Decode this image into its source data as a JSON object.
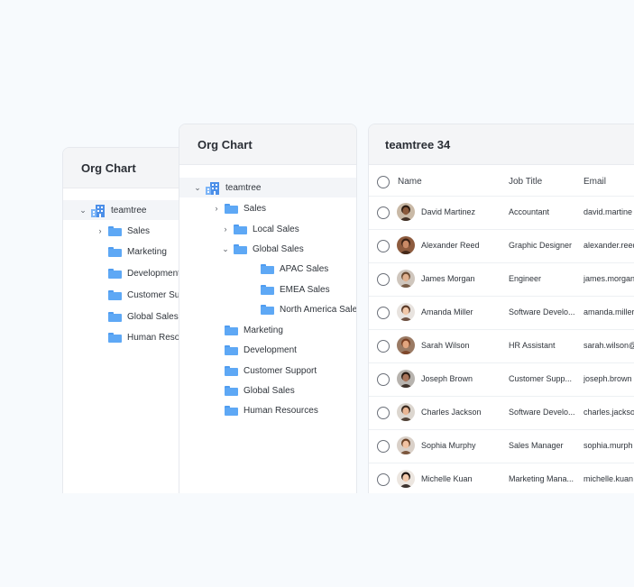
{
  "back_panel": {
    "title": "Org Chart",
    "root": "teamtree",
    "items": [
      {
        "label": "Sales",
        "expandable": true
      },
      {
        "label": "Marketing",
        "expandable": false
      },
      {
        "label": "Development",
        "expandable": false
      },
      {
        "label": "Customer Sup",
        "expandable": false
      },
      {
        "label": "Global Sales",
        "expandable": false
      },
      {
        "label": "Human Resou",
        "expandable": false
      }
    ]
  },
  "org_panel": {
    "title": "Org Chart",
    "root": "teamtree",
    "items": [
      {
        "label": "Sales",
        "level": 1,
        "caret": "›"
      },
      {
        "label": "Local Sales",
        "level": 2,
        "caret": "›"
      },
      {
        "label": "Global Sales",
        "level": 2,
        "caret": "⌄"
      },
      {
        "label": "APAC Sales",
        "level": 3,
        "caret": ""
      },
      {
        "label": "EMEA Sales",
        "level": 3,
        "caret": ""
      },
      {
        "label": "North America Sales",
        "level": 3,
        "caret": ""
      },
      {
        "label": "Marketing",
        "level": 1,
        "caret": ""
      },
      {
        "label": "Development",
        "level": 1,
        "caret": ""
      },
      {
        "label": "Customer Support",
        "level": 1,
        "caret": ""
      },
      {
        "label": "Global Sales",
        "level": 1,
        "caret": ""
      },
      {
        "label": "Human Resources",
        "level": 1,
        "caret": ""
      }
    ]
  },
  "table_panel": {
    "title": "teamtree 34",
    "columns": {
      "name": "Name",
      "job": "Job Title",
      "email": "Email"
    },
    "rows": [
      {
        "name": "David Martinez",
        "job": "Accountant",
        "email": "david.martine",
        "skin": "#8a5a3c",
        "hair": "#2a1a10",
        "bg": "#c9b9a6"
      },
      {
        "name": "Alexander Reed",
        "job": "Graphic Designer",
        "email": "alexander.reed",
        "skin": "#c98a66",
        "hair": "#3a2114",
        "bg": "#8d5b3e"
      },
      {
        "name": "James Morgan",
        "job": "Engineer",
        "email": "james.morgan",
        "skin": "#e0b08e",
        "hair": "#6a4a32",
        "bg": "#cfc6bd"
      },
      {
        "name": "Amanda Miller",
        "job": "Software Develo...",
        "email": "amanda.miller",
        "skin": "#f0c7a8",
        "hair": "#5a3a28",
        "bg": "#e8e3df"
      },
      {
        "name": "Sarah Wilson",
        "job": "HR Assistant",
        "email": "sarah.wilson@",
        "skin": "#e2a57f",
        "hair": "#7a3f22",
        "bg": "#9a7a64"
      },
      {
        "name": "Joseph Brown",
        "job": "Customer Supp...",
        "email": "joseph.brown",
        "skin": "#a8745a",
        "hair": "#2a1c14",
        "bg": "#b7b3ae"
      },
      {
        "name": "Charles Jackson",
        "job": "Software Develo...",
        "email": "charles.jackso",
        "skin": "#e9b694",
        "hair": "#3b2a1f",
        "bg": "#dcd6cf"
      },
      {
        "name": "Sophia Murphy",
        "job": "Sales Manager",
        "email": "sophia.murph",
        "skin": "#f1c2a2",
        "hair": "#6b4226",
        "bg": "#d9d0c8"
      },
      {
        "name": "Michelle Kuan",
        "job": "Marketing Mana...",
        "email": "michelle.kuan",
        "skin": "#f2c8aa",
        "hair": "#1e1410",
        "bg": "#ece6e0"
      }
    ]
  },
  "colors": {
    "folder": "#5ea8f5",
    "background": "#f7fafd",
    "header": "#f4f5f7"
  }
}
